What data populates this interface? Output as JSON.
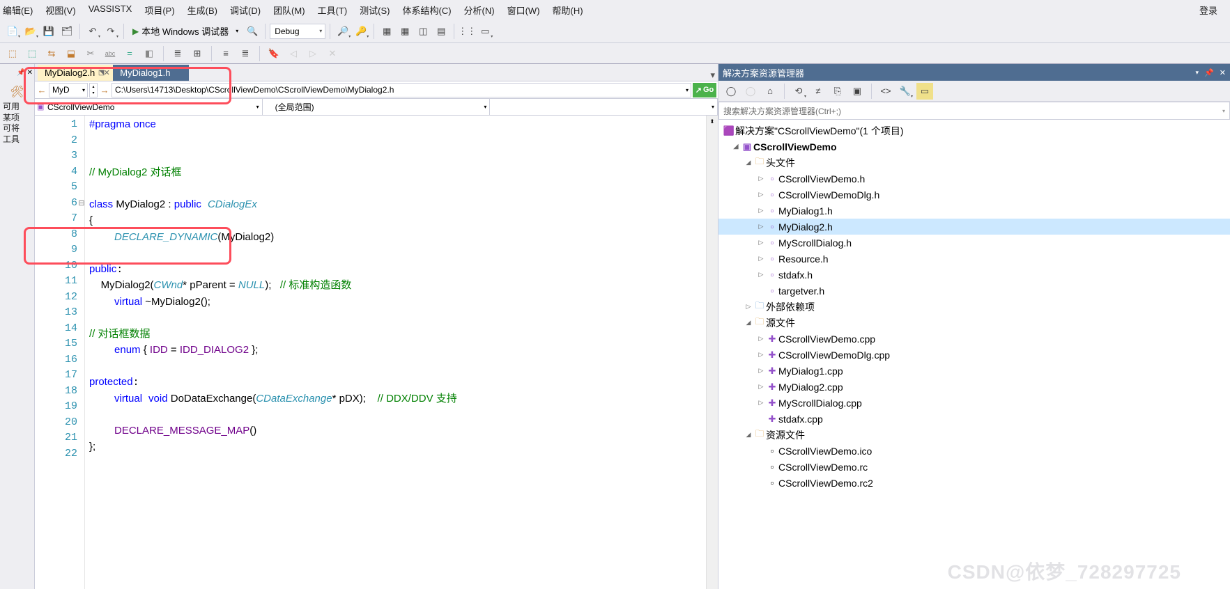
{
  "menu": {
    "edit": "编辑(E)",
    "view": "视图(V)",
    "vassist": "VASSISTX",
    "project": "项目(P)",
    "build": "生成(B)",
    "debug": "调试(D)",
    "team": "团队(M)",
    "tools": "工具(T)",
    "test": "测试(S)",
    "architecture": "体系结构(C)",
    "analyze": "分析(N)",
    "window": "窗口(W)",
    "help": "帮助(H)",
    "login": "登录"
  },
  "toolbar": {
    "localDebugger": "本地 Windows 调试器",
    "config": "Debug"
  },
  "tabs": {
    "t0": "MyDialog2.h",
    "t1": "MyDialog1.h"
  },
  "pathbar": {
    "scope": "MyD",
    "path": "C:\\Users\\14713\\Desktop\\CScrollViewDemo\\CScrollViewDemo\\MyDialog2.h",
    "go": "Go"
  },
  "scopebar": {
    "s0": "CScrollViewDemo",
    "s1": "(全局范围)",
    "s2": ""
  },
  "leftdock": {
    "l0": "可用",
    "l1": "某项",
    "l2": "可将",
    "l3": "工具"
  },
  "solution": {
    "title": "解决方案资源管理器",
    "search": "搜索解决方案资源管理器(Ctrl+;)",
    "root": "解决方案\"CScrollViewDemo\"(1 个项目)",
    "proj": "CScrollViewDemo",
    "headers": "头文件",
    "h0": "CScrollViewDemo.h",
    "h1": "CScrollViewDemoDlg.h",
    "h2": "MyDialog1.h",
    "h3": "MyDialog2.h",
    "h4": "MyScrollDialog.h",
    "h5": "Resource.h",
    "h6": "stdafx.h",
    "h7": "targetver.h",
    "ext": "外部依赖项",
    "sources": "源文件",
    "c0": "CScrollViewDemo.cpp",
    "c1": "CScrollViewDemoDlg.cpp",
    "c2": "MyDialog1.cpp",
    "c3": "MyDialog2.cpp",
    "c4": "MyScrollDialog.cpp",
    "c5": "stdafx.cpp",
    "res": "资源文件",
    "r0": "CScrollViewDemo.ico",
    "r1": "CScrollViewDemo.rc",
    "r2": "CScrollViewDemo.rc2"
  },
  "watermark": "CSDN@依梦_728297725",
  "code": {
    "l1a": "#pragma",
    "l1b": " once",
    "l4": "// MyDialog2 对话框",
    "l6a": "class",
    "l6b": " MyDialog2 : ",
    "l6c": "public",
    "l6d": "CDialogEx",
    "l7": "{",
    "l8a": "DECLARE_DYNAMIC",
    "l8b": "(MyDialog2)",
    "l10": "public",
    "l11a": "    MyDialog2(",
    "l11b": "CWnd",
    "l11c": "* pParent = ",
    "l11d": "NULL",
    "l11e": ");   ",
    "l11f": "// 标准构造函数",
    "l12a": "virtual",
    "l12b": " ~MyDialog2();",
    "l14": "// 对话框数据",
    "l15a": "enum",
    "l15b": " { ",
    "l15c": "IDD",
    "l15d": " = ",
    "l15e": "IDD_DIALOG2",
    "l15f": " };",
    "l17": "protected",
    "l18a": "virtual",
    "l18b": "void",
    "l18c": " DoDataExchange(",
    "l18d": "CDataExchange",
    "l18e": "* pDX);    ",
    "l18f": "// DDX/DDV 支持",
    "l20a": "DECLARE_MESSAGE_MAP",
    "l20b": "()",
    "l21": "};"
  }
}
